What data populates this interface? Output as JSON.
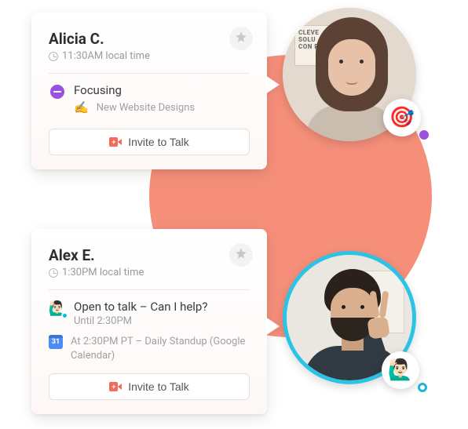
{
  "cards": [
    {
      "name": "Alicia C.",
      "local_time": "11:30AM local time",
      "status": {
        "icon": "dnd",
        "label": "Focusing",
        "detail_icon": "✍️",
        "detail": "New Website Designs"
      },
      "invite_label": "Invite to Talk"
    },
    {
      "name": "Alex E.",
      "local_time": "1:30PM local time",
      "status": {
        "icon": "🙋🏻‍♂️",
        "label": "Open to talk – Can I help?",
        "until": "Until 2:30PM"
      },
      "calendar": {
        "text": "At 2:30PM PT – Daily Standup (Google Calendar)"
      },
      "invite_label": "Invite to Talk"
    }
  ],
  "avatars": [
    {
      "chip_emoji": "🎯",
      "presence": "dnd",
      "poster_text": "CLEVE SOLU CON PRO"
    },
    {
      "chip_emoji": "🙋🏻‍♂️",
      "presence": "available"
    }
  ],
  "colors": {
    "accent_coral": "#f58f7a",
    "dnd_purple": "#9b51e0",
    "available_cyan": "#1fb6d6",
    "cam_red": "#f26a5a"
  }
}
